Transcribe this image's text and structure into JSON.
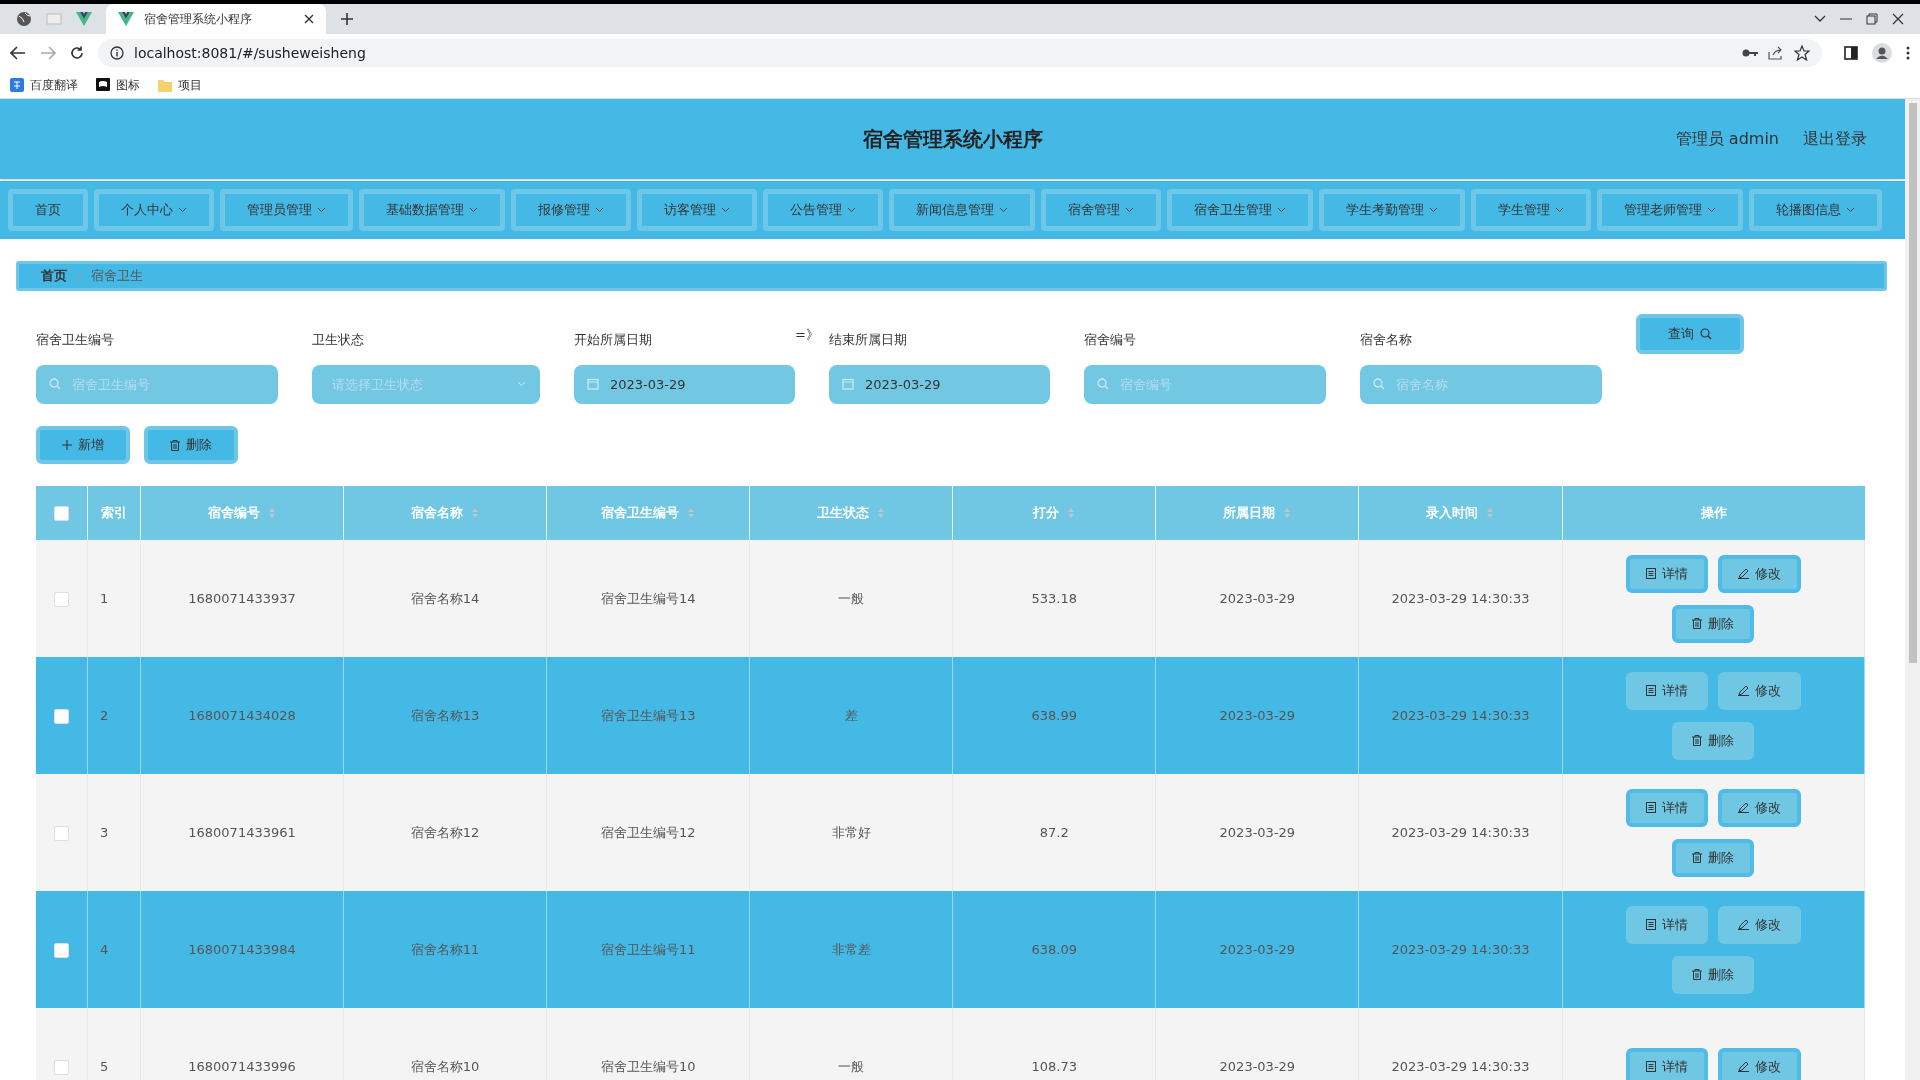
{
  "browser": {
    "tab_title": "宿舍管理系统小程序",
    "url": "localhost:8081/#/susheweisheng",
    "bookmarks": [
      {
        "label": "百度翻译",
        "kind": "translate"
      },
      {
        "label": "图标",
        "kind": "flag"
      },
      {
        "label": "项目",
        "kind": "folder"
      }
    ]
  },
  "header": {
    "title": "宿舍管理系统小程序",
    "user": "管理员 admin",
    "logout": "退出登录"
  },
  "nav": [
    {
      "label": "首页",
      "dropdown": false
    },
    {
      "label": "个人中心",
      "dropdown": true
    },
    {
      "label": "管理员管理",
      "dropdown": true
    },
    {
      "label": "基础数据管理",
      "dropdown": true
    },
    {
      "label": "报修管理",
      "dropdown": true
    },
    {
      "label": "访客管理",
      "dropdown": true
    },
    {
      "label": "公告管理",
      "dropdown": true
    },
    {
      "label": "新闻信息管理",
      "dropdown": true
    },
    {
      "label": "宿舍管理",
      "dropdown": true
    },
    {
      "label": "宿舍卫生管理",
      "dropdown": true
    },
    {
      "label": "学生考勤管理",
      "dropdown": true
    },
    {
      "label": "学生管理",
      "dropdown": true
    },
    {
      "label": "管理老师管理",
      "dropdown": true
    },
    {
      "label": "轮播图信息",
      "dropdown": true
    }
  ],
  "breadcrumb": {
    "separator": "/",
    "items": [
      "首页",
      "宿舍卫生"
    ]
  },
  "filters": [
    {
      "label": "宿舍卫生编号",
      "kind": "search",
      "placeholder": "宿舍卫生编号"
    },
    {
      "label": "卫生状态",
      "kind": "select",
      "placeholder": "请选择卫生状态"
    },
    {
      "label": "开始所属日期",
      "kind": "date",
      "value": "2023-03-29"
    },
    {
      "label": "结束所属日期",
      "kind": "date",
      "value": "2023-03-29",
      "prefix": "=》"
    },
    {
      "label": "宿舍编号",
      "kind": "search",
      "placeholder": "宿舍编号"
    },
    {
      "label": "宿舍名称",
      "kind": "search",
      "placeholder": "宿舍名称"
    }
  ],
  "query_button": "查询",
  "actions": [
    {
      "label": "新增",
      "kind": "add"
    },
    {
      "label": "删除",
      "kind": "delete"
    }
  ],
  "table": {
    "header_checked": false,
    "columns": [
      {
        "label": "索引",
        "sortable": false
      },
      {
        "label": "宿舍编号",
        "sortable": true
      },
      {
        "label": "宿舍名称",
        "sortable": true
      },
      {
        "label": "宿舍卫生编号",
        "sortable": true
      },
      {
        "label": "卫生状态",
        "sortable": true
      },
      {
        "label": "打分",
        "sortable": true
      },
      {
        "label": "所属日期",
        "sortable": true
      },
      {
        "label": "录入时间",
        "sortable": true
      },
      {
        "label": "操作",
        "sortable": false
      }
    ],
    "rows": [
      {
        "checked": false,
        "cells": [
          "1",
          "1680071433937",
          "宿舍名称14",
          "宿舍卫生编号14",
          "一般",
          "533.18",
          "2023-03-29",
          "2023-03-29 14:30:33"
        ],
        "buttons": [
          {
            "label": "详情",
            "kind": "detail"
          },
          {
            "label": "修改",
            "kind": "edit"
          },
          {
            "label": "删除",
            "kind": "delete"
          }
        ]
      },
      {
        "checked": false,
        "cells": [
          "2",
          "1680071434028",
          "宿舍名称13",
          "宿舍卫生编号13",
          "差",
          "638.99",
          "2023-03-29",
          "2023-03-29 14:30:33"
        ],
        "buttons": [
          {
            "label": "详情",
            "kind": "detail"
          },
          {
            "label": "修改",
            "kind": "edit"
          },
          {
            "label": "删除",
            "kind": "delete"
          }
        ]
      },
      {
        "checked": false,
        "cells": [
          "3",
          "1680071433961",
          "宿舍名称12",
          "宿舍卫生编号12",
          "非常好",
          "87.2",
          "2023-03-29",
          "2023-03-29 14:30:33"
        ],
        "buttons": [
          {
            "label": "详情",
            "kind": "detail"
          },
          {
            "label": "修改",
            "kind": "edit"
          },
          {
            "label": "删除",
            "kind": "delete"
          }
        ]
      },
      {
        "checked": false,
        "cells": [
          "4",
          "1680071433984",
          "宿舍名称11",
          "宿舍卫生编号11",
          "非常差",
          "638.09",
          "2023-03-29",
          "2023-03-29 14:30:33"
        ],
        "buttons": [
          {
            "label": "详情",
            "kind": "detail"
          },
          {
            "label": "修改",
            "kind": "edit"
          },
          {
            "label": "删除",
            "kind": "delete"
          }
        ]
      },
      {
        "checked": false,
        "cells": [
          "5",
          "1680071433996",
          "宿舍名称10",
          "宿舍卫生编号10",
          "一般",
          "108.73",
          "2023-03-29",
          "2023-03-29 14:30:33"
        ],
        "buttons": [
          {
            "label": "详情",
            "kind": "detail"
          },
          {
            "label": "修改",
            "kind": "edit"
          }
        ]
      }
    ]
  }
}
